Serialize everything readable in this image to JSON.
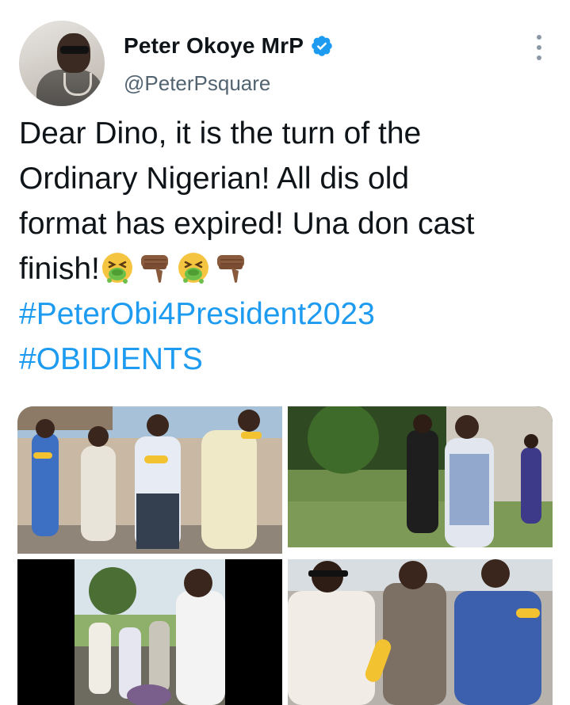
{
  "author": {
    "display_name": "Peter Okoye MrP",
    "handle": "@PeterPsquare",
    "verified": true,
    "avatar_icon": "profile-photo"
  },
  "tweet": {
    "lines": [
      "Dear Dino, it is the turn of the",
      "Ordinary Nigerian! All dis old",
      "format has expired! Una don cast",
      "finish!"
    ],
    "emojis": [
      "face-vomiting",
      "thumbs-down",
      "face-vomiting",
      "thumbs-down"
    ],
    "hashtags": [
      "#PeterObi4President2023",
      "#OBIDIENTS"
    ]
  },
  "media": {
    "count": 4,
    "items": [
      {
        "icon": "photo-men-eating-corn-walking"
      },
      {
        "icon": "photo-man-in-blue-agbada-yard"
      },
      {
        "icon": "photo-video-still-crowd"
      },
      {
        "icon": "photo-men-eating-corn-closeup"
      }
    ]
  },
  "colors": {
    "text": "#0f1419",
    "secondary": "#536471",
    "link": "#1d9bf0",
    "verified": "#1d9bf0"
  }
}
